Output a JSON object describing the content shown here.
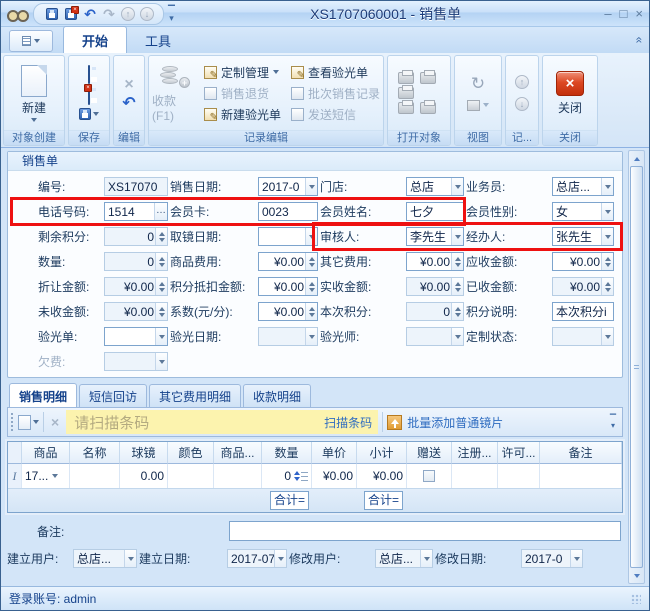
{
  "colors": {
    "highlight_red": "#ee1111",
    "close_button_red": "#c22f0c",
    "accent_blue": "#15428b",
    "scan_yellow": "#fcf3ae"
  },
  "titlebar": {
    "title": "XS1707060001 - 销售单",
    "qat_icons": [
      "save-icon",
      "save-close-icon",
      "undo-icon",
      "redo-icon",
      "scroll-up-icon",
      "scroll-down-icon"
    ],
    "controls": {
      "min": "–",
      "max": "□",
      "close": "×"
    }
  },
  "ribbon": {
    "tabs": [
      {
        "label": "开始",
        "active": true
      },
      {
        "label": "工具",
        "active": false
      }
    ],
    "groups": {
      "create": {
        "label": "对象创建",
        "new_label": "新建"
      },
      "save": {
        "label": "保存"
      },
      "edit": {
        "label": "编辑"
      },
      "record": {
        "label": "记录编辑",
        "receive_label": "收款(F1)",
        "receive_enabled": false,
        "items": [
          {
            "label": "定制管理",
            "enabled": true,
            "arrow": true
          },
          {
            "label": "销售退货",
            "enabled": false,
            "arrow": false
          },
          {
            "label": "新建验光单",
            "enabled": true,
            "arrow": false
          },
          {
            "label": "查看验光单",
            "enabled": true,
            "arrow": false
          },
          {
            "label": "批次销售记录",
            "enabled": false,
            "arrow": false
          },
          {
            "label": "发送短信",
            "enabled": false,
            "arrow": false
          }
        ]
      },
      "open": {
        "label": "打开对象"
      },
      "view": {
        "label": "视图"
      },
      "rec2": {
        "label": "记..."
      },
      "close": {
        "label": "关闭",
        "button_label": "关闭"
      }
    }
  },
  "form": {
    "caption": "销售单",
    "rows": [
      {
        "fields": [
          {
            "name": "order-no",
            "label": "编号:",
            "value": "XS17070",
            "type": "text",
            "state": "dim"
          },
          {
            "name": "sale-date",
            "label": "销售日期:",
            "value": "2017-0",
            "type": "combo",
            "state": "white"
          },
          {
            "name": "store",
            "label": "门店:",
            "value": "总店",
            "type": "combo",
            "state": "white"
          },
          {
            "name": "salesman",
            "label": "业务员:",
            "value": "总店...",
            "type": "combo",
            "state": "white"
          }
        ]
      },
      {
        "fields": [
          {
            "name": "phone-number",
            "label": "电话号码:",
            "value": "1514",
            "type": "ellipsis",
            "state": "white"
          },
          {
            "name": "member-card",
            "label": "会员卡:",
            "value": "0023",
            "type": "text",
            "state": "white"
          },
          {
            "name": "member-name",
            "label": "会员姓名:",
            "value": "七夕",
            "type": "text",
            "state": "white"
          },
          {
            "name": "member-gender",
            "label": "会员性别:",
            "value": "女",
            "type": "combo",
            "state": "white"
          }
        ]
      },
      {
        "fields": [
          {
            "name": "remaining-points",
            "label": "剩余积分:",
            "value": "0",
            "type": "spin",
            "state": "dim",
            "align": "right"
          },
          {
            "name": "pickup-date",
            "label": "取镜日期:",
            "value": "",
            "type": "combo",
            "state": "white"
          },
          {
            "name": "auditor",
            "label": "审核人:",
            "value": "李先生",
            "type": "combo",
            "state": "white"
          },
          {
            "name": "handler",
            "label": "经办人:",
            "value": "张先生",
            "type": "combo",
            "state": "white"
          }
        ]
      },
      {
        "fields": [
          {
            "name": "quantity",
            "label": "数量:",
            "value": "0",
            "type": "spin",
            "state": "dim",
            "align": "right"
          },
          {
            "name": "product-fee",
            "label": "商品费用:",
            "value": "¥0.00",
            "type": "spin",
            "state": "white",
            "align": "right"
          },
          {
            "name": "other-fee",
            "label": "其它费用:",
            "value": "¥0.00",
            "type": "spin",
            "state": "white",
            "align": "right"
          },
          {
            "name": "receivable-amount",
            "label": "应收金额:",
            "value": "¥0.00",
            "type": "spin",
            "state": "white",
            "align": "right"
          }
        ]
      },
      {
        "fields": [
          {
            "name": "discount-amount",
            "label": "折让金额:",
            "value": "¥0.00",
            "type": "spin",
            "state": "dim",
            "align": "right"
          },
          {
            "name": "points-deduction",
            "label": "积分抵扣金额:",
            "value": "¥0.00",
            "type": "spin",
            "state": "white",
            "align": "right"
          },
          {
            "name": "actual-received",
            "label": "实收金额:",
            "value": "¥0.00",
            "type": "spin",
            "state": "dim",
            "align": "right"
          },
          {
            "name": "received-amount",
            "label": "已收金额:",
            "value": "¥0.00",
            "type": "spin",
            "state": "dim",
            "align": "right"
          }
        ]
      },
      {
        "fields": [
          {
            "name": "unreceived-amount",
            "label": "未收金额:",
            "value": "¥0.00",
            "type": "spin",
            "state": "dim",
            "align": "right"
          },
          {
            "name": "coefficient",
            "label": "系数(元/分):",
            "value": "¥0.00",
            "type": "spin",
            "state": "white",
            "align": "right"
          },
          {
            "name": "current-points",
            "label": "本次积分:",
            "value": "0",
            "type": "spin",
            "state": "dim",
            "align": "right"
          },
          {
            "name": "points-note",
            "label": "积分说明:",
            "value": "本次积分i",
            "type": "text",
            "state": "white"
          }
        ]
      },
      {
        "fields": [
          {
            "name": "optometry-form",
            "label": "验光单:",
            "value": "",
            "type": "combo",
            "state": "white"
          },
          {
            "name": "optometry-date",
            "label": "验光日期:",
            "value": "",
            "type": "combo",
            "state": "dim"
          },
          {
            "name": "optometrist",
            "label": "验光师:",
            "value": "",
            "type": "combo",
            "state": "dim"
          },
          {
            "name": "custom-status",
            "label": "定制状态:",
            "value": "",
            "type": "combo",
            "state": "dim"
          }
        ]
      },
      {
        "fields": [
          {
            "name": "arrears",
            "label": "欠费:",
            "value": "",
            "type": "combo",
            "state": "dim",
            "label_dim": true
          },
          null,
          null,
          null
        ]
      }
    ]
  },
  "detail": {
    "tabs": [
      {
        "label": "销售明细",
        "active": true
      },
      {
        "label": "短信回访",
        "active": false
      },
      {
        "label": "其它费用明细",
        "active": false
      },
      {
        "label": "收款明细",
        "active": false
      }
    ]
  },
  "scan": {
    "placeholder": "请扫描条码",
    "scan_button": "扫描条码",
    "batch_button": "批量添加普通镜片"
  },
  "grid": {
    "headers": [
      "商品",
      "名称",
      "球镜",
      "颜色",
      "商品...",
      "数量",
      "单价",
      "小计",
      "赠送",
      "注册...",
      "许可...",
      "备注"
    ],
    "row": {
      "selector": "I",
      "cells": [
        {
          "v": "17...",
          "combo": true
        },
        {
          "v": ""
        },
        {
          "v": "0.00",
          "right": true
        },
        {
          "v": ""
        },
        {
          "v": ""
        },
        {
          "v": "0",
          "qty": true,
          "right": true
        },
        {
          "v": "¥0.00",
          "right": true
        },
        {
          "v": "¥0.00",
          "right": true
        },
        {
          "check": true,
          "checked": false
        },
        {
          "v": ""
        },
        {
          "v": ""
        },
        {
          "v": ""
        }
      ]
    },
    "total_label": "合计="
  },
  "footer": {
    "remark_label": "备注:",
    "remark_value": "",
    "fields": [
      {
        "name": "created-by",
        "label": "建立用户:",
        "value": "总店...",
        "type": "combo",
        "state": "dim"
      },
      {
        "name": "created-date",
        "label": "建立日期:",
        "value": "2017-07",
        "type": "combo",
        "state": "dim"
      },
      {
        "name": "modified-by",
        "label": "修改用户:",
        "value": "总店...",
        "type": "combo",
        "state": "dim"
      },
      {
        "name": "modified-date",
        "label": "修改日期:",
        "value": "2017-0",
        "type": "combo",
        "state": "dim"
      }
    ]
  },
  "statusbar": {
    "text": "登录账号: admin"
  }
}
